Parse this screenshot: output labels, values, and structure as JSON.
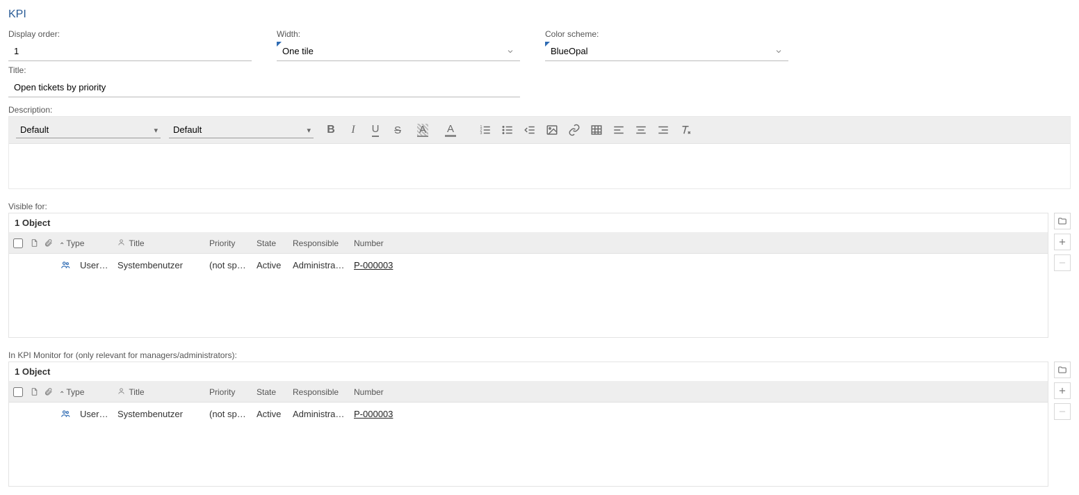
{
  "page_title": "KPI",
  "fields": {
    "display_order": {
      "label": "Display order:",
      "value": "1"
    },
    "width": {
      "label": "Width:",
      "value": "One tile"
    },
    "color_scheme": {
      "label": "Color scheme:",
      "value": "BlueOpal"
    },
    "title": {
      "label": "Title:",
      "value": "Open tickets by priority"
    },
    "description": {
      "label": "Description:"
    }
  },
  "rte": {
    "font_family": "Default",
    "font_size": "Default"
  },
  "visible_for": {
    "label": "Visible for:",
    "summary": "1 Object",
    "columns": {
      "type": "Type",
      "title": "Title",
      "priority": "Priority",
      "state": "State",
      "responsible": "Responsible",
      "number": "Number"
    },
    "rows": [
      {
        "type": "User group",
        "title": "Systembenutzer",
        "priority": "(not spec...",
        "state": "Active",
        "responsible": "Administratio...",
        "number": "P-000003"
      }
    ]
  },
  "kpi_monitor_for": {
    "label": "In KPI Monitor for (only relevant for managers/administrators):",
    "summary": "1 Object",
    "columns": {
      "type": "Type",
      "title": "Title",
      "priority": "Priority",
      "state": "State",
      "responsible": "Responsible",
      "number": "Number"
    },
    "rows": [
      {
        "type": "User group",
        "title": "Systembenutzer",
        "priority": "(not spec...",
        "state": "Active",
        "responsible": "Administratio...",
        "number": "P-000003"
      }
    ]
  }
}
